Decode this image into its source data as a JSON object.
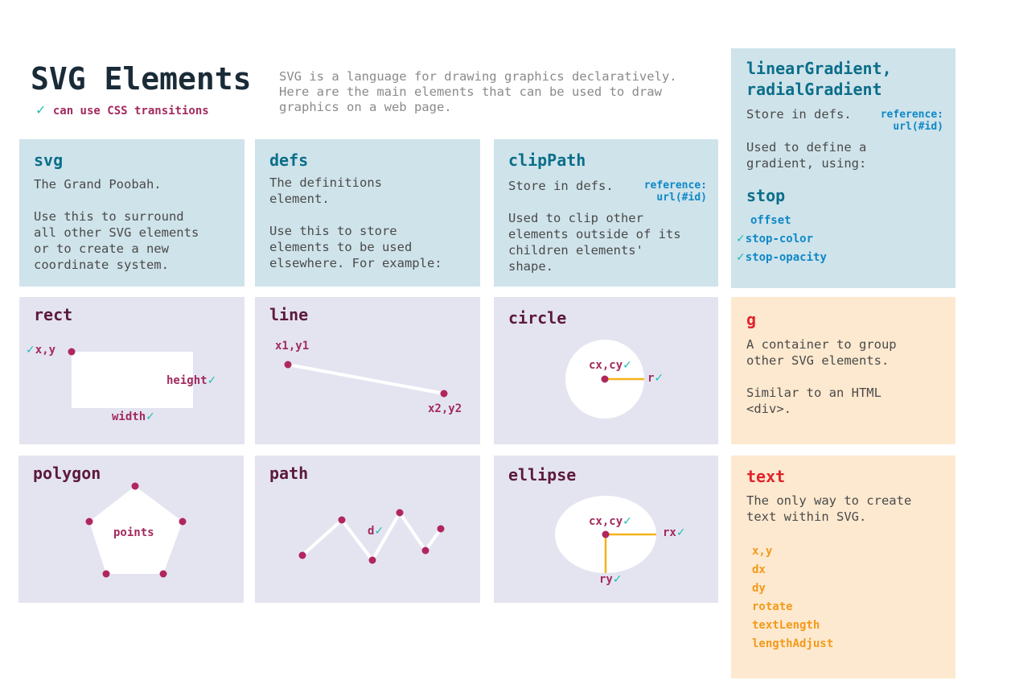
{
  "header": {
    "title": "SVG Elements",
    "css_note": "can use CSS transitions",
    "intro": [
      "SVG is a language for drawing graphics declaratively.",
      "Here are the main elements that can be used to draw",
      "graphics on a web page."
    ]
  },
  "cards": {
    "svg": {
      "title": "svg",
      "lines": [
        "The Grand Poobah.",
        "",
        "Use this to surround",
        "all other SVG elements",
        "or to create a new",
        "coordinate system."
      ]
    },
    "defs": {
      "title": "defs",
      "lines": [
        "The definitions",
        "element.",
        "",
        "Use this to store",
        "elements to be used",
        "elsewhere. For example:"
      ]
    },
    "clippath": {
      "title": "clipPath",
      "store": "Store in defs.",
      "reference": [
        "reference:",
        "url(#id)"
      ],
      "lines": [
        "Used to clip other",
        "elements outside of its",
        "children elements'",
        "shape."
      ]
    },
    "gradient": {
      "title": [
        "linearGradient,",
        "radialGradient"
      ],
      "store": "Store in defs.",
      "reference": [
        "reference:",
        "url(#id)"
      ],
      "lines": [
        "Used to define a",
        "gradient, using:"
      ],
      "stop_title": "stop",
      "stop_attrs": [
        "offset",
        "stop-color",
        "stop-opacity"
      ]
    },
    "rect": {
      "title": "rect",
      "xy": "x,y",
      "height": "height",
      "width": "width"
    },
    "line": {
      "title": "line",
      "p1": "x1,y1",
      "p2": "x2,y2"
    },
    "circle": {
      "title": "circle",
      "center": "cx,cy",
      "r": "r"
    },
    "g": {
      "title": "g",
      "lines": [
        "A container to group",
        "other SVG elements.",
        "",
        "Similar to an HTML",
        "<div>."
      ]
    },
    "polygon": {
      "title": "polygon",
      "points": "points"
    },
    "path": {
      "title": "path",
      "d": "d"
    },
    "ellipse": {
      "title": "ellipse",
      "center": "cx,cy",
      "rx": "rx",
      "ry": "ry"
    },
    "text": {
      "title": "text",
      "lines": [
        "The only way to create",
        "text within SVG."
      ],
      "attrs": [
        "x,y",
        "dx",
        "dy",
        "rotate",
        "textLength",
        "lengthAdjust"
      ]
    }
  },
  "colors": {
    "blue_card": "#cfe3ea",
    "lavender_card": "#e4e4f1",
    "peach_card": "#fde9cf",
    "dot": "#b0265e",
    "check": "#1fbfb3",
    "orange": "#f5b21b",
    "teal_heading": "#0b6e8a",
    "plum_heading": "#5c1a3b",
    "red_heading": "#e1232b"
  },
  "icons": {
    "check": "check-icon"
  }
}
